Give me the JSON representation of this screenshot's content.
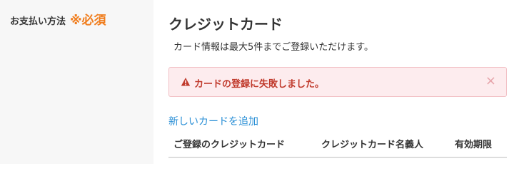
{
  "field": {
    "label": "お支払い方法",
    "required_mark": "※必須"
  },
  "section": {
    "title": "クレジットカード",
    "description": "カード情報は最大5件までご登録いただけます。"
  },
  "alert": {
    "icon": "warning-triangle-icon",
    "message": "カードの登録に失敗しました。",
    "close_label": "×",
    "background_color": "#fdecee",
    "text_color": "#c0392b"
  },
  "add_card_link": "新しいカードを追加",
  "table": {
    "headers": [
      "ご登録のクレジットカード",
      "クレジットカード名義人",
      "有効期限"
    ]
  },
  "colors": {
    "required_accent": "#f07c1b",
    "link": "#2a8fd6"
  }
}
